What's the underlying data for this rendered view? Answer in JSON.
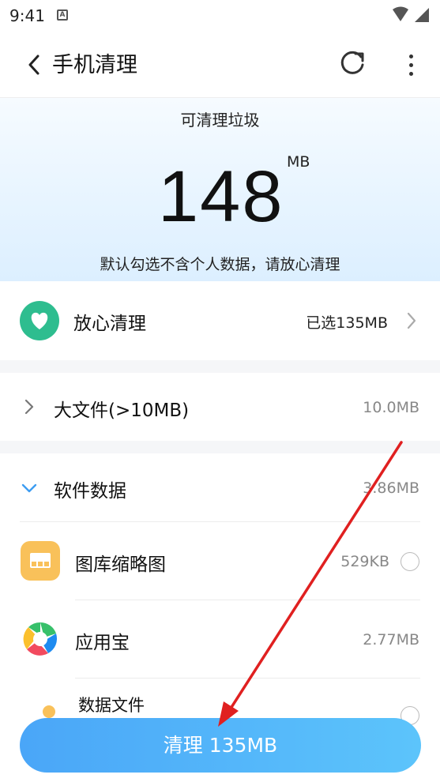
{
  "status_bar": {
    "time": "9:41",
    "notification_icon": "A"
  },
  "header": {
    "title": "手机清理",
    "back_icon": "chevron-left-icon",
    "refresh_icon": "refresh-icon",
    "more_icon": "more-vertical-icon"
  },
  "summary": {
    "label": "可清理垃圾",
    "amount": "148",
    "unit": "MB",
    "note": "默认勾选不含个人数据，请放心清理"
  },
  "safe_clean": {
    "title": "放心清理",
    "selected": "已选135MB",
    "icon": "heart-icon",
    "accent": "#2ebd8f"
  },
  "large_files": {
    "title": "大文件(>10MB)",
    "size": "10.0MB"
  },
  "software_data": {
    "title": "软件数据",
    "size": "3.86MB",
    "items": [
      {
        "name": "图库缩略图",
        "size": "529KB",
        "icon": "gallery-icon"
      },
      {
        "name": "应用宝",
        "size": "2.77MB",
        "icon": "app-store-icon"
      },
      {
        "name": "数据文件",
        "size": "",
        "icon": "data-file-icon"
      }
    ]
  },
  "action": {
    "clean_label": "清理 135MB",
    "accent": "#4aa6f8"
  },
  "annotation": {
    "arrow_color": "#e02020"
  }
}
